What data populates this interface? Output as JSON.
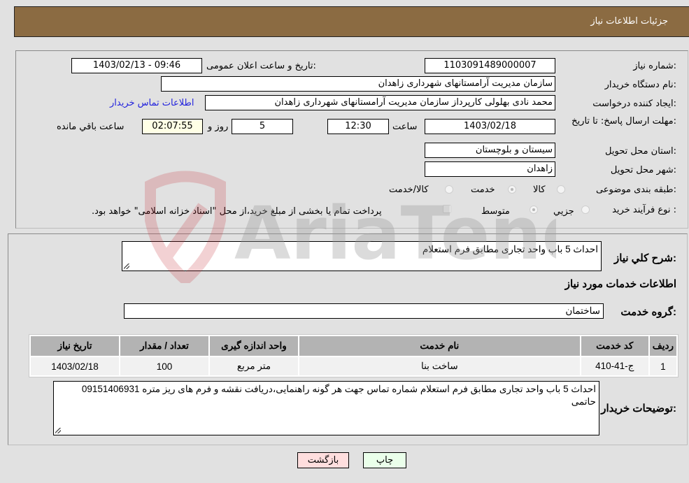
{
  "header": {
    "title": "جزئیات اطلاعات نیاز"
  },
  "form": {
    "need_number": {
      "label": "شماره نیاز:",
      "value": "1103091489000007"
    },
    "announce_datetime": {
      "label": "تاریخ و ساعت اعلان عمومی:",
      "value": "1403/02/13 - 09:46"
    },
    "buyer_org": {
      "label": "نام دستگاه خریدار:",
      "value": "سازمان مدیریت آرامستانهای شهرداری زاهدان"
    },
    "requester": {
      "label": "ایجاد کننده درخواست:",
      "value": "محمد نادی بهلولی کارپرداز سازمان مدیریت آرامستانهای شهرداری زاهدان",
      "contact_link": "اطلاعات تماس خریدار"
    },
    "deadline": {
      "label": "مهلت ارسال پاسخ: تا تاریخ:",
      "date": "1403/02/18",
      "time_label": "ساعت",
      "time": "12:30",
      "days": "5",
      "days_label": "روز و",
      "remaining": "02:07:55",
      "remaining_label": "ساعت باقي مانده"
    },
    "province": {
      "label": "استان محل تحویل:",
      "value": "سیستان و بلوچستان"
    },
    "city": {
      "label": "شهر محل تحویل:",
      "value": "زاهدان"
    },
    "category": {
      "label": "طبقه بندی موضوعی:",
      "options": [
        "کالا",
        "خدمت",
        "کالا/خدمت"
      ],
      "selected": "خدمت"
    },
    "purchase_type": {
      "label": "نوع فرآیند خرید :",
      "options": [
        "جزيي",
        "متوسط"
      ],
      "selected": "متوسط",
      "treasury_note": "پرداخت تمام یا بخشی از مبلغ خرید،از محل \"اسناد خزانه اسلامی\" خواهد بود."
    }
  },
  "details": {
    "summary_label": "شرح کلي نیاز:",
    "summary_value": "احداث 5 باب واحد تجاری مطابق فرم استعلام",
    "services_heading": "اطلاعات خدمات مورد نیاز",
    "service_group_label": "گروه خدمت:",
    "service_group_value": "ساختمان",
    "table": {
      "headers": [
        "ردیف",
        "کد خدمت",
        "نام خدمت",
        "واحد اندازه گیری",
        "تعداد / مقدار",
        "تاریخ نیاز"
      ],
      "rows": [
        [
          "1",
          "ج-41-410",
          "ساخت بنا",
          "متر مربع",
          "100",
          "1403/02/18"
        ]
      ]
    },
    "buyer_notes_label": "توضیحات خریدار:",
    "buyer_notes_value": "احداث 5 باب واحد تجاری مطابق فرم استعلام شماره تماس جهت هر گونه راهنمایی،دریافت نقشه و  فرم های  ریز متره 09151406931 حاتمی"
  },
  "buttons": {
    "print": "چاپ",
    "back": "بازگشت"
  },
  "watermark": {
    "text": "AriaTender.neT"
  }
}
